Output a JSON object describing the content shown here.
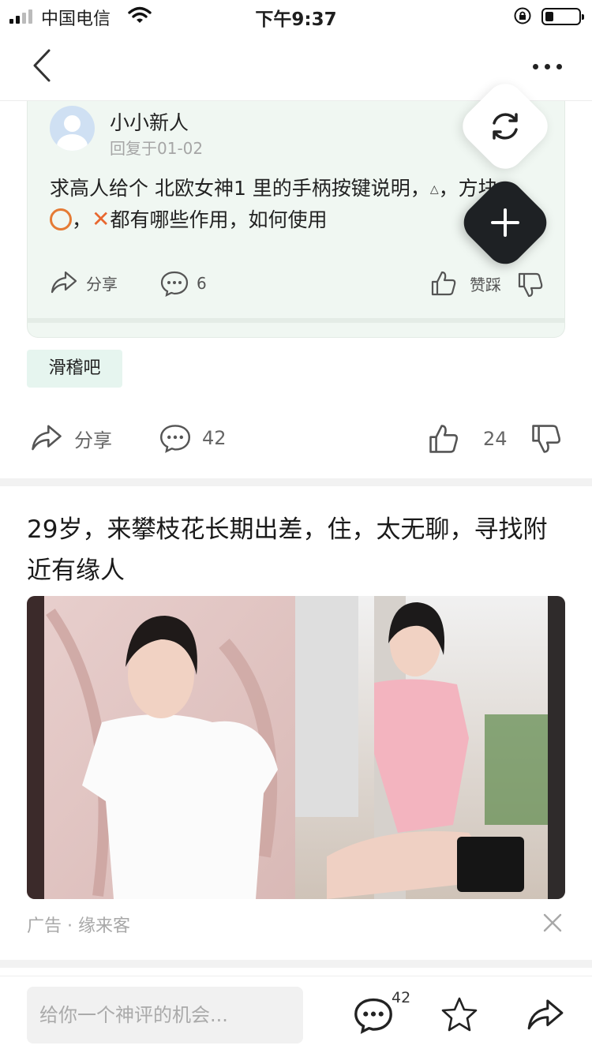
{
  "status_bar": {
    "carrier": "中国电信",
    "time": "下午9:37",
    "icons": [
      "signal-icon",
      "wifi-icon",
      "rotation-lock-icon",
      "battery-icon"
    ]
  },
  "nav": {
    "icons": [
      "back-arrow-icon",
      "more-dots-icon"
    ]
  },
  "quoted_reply": {
    "username": "小小新人",
    "reply_time": "回复于01-02",
    "content_part1": "求高人给个 北欧女神1 里的手柄按键说明，",
    "content_triangle": "△",
    "content_part2": "，方块，",
    "content_circle_sep": "，",
    "content_cross": "✕",
    "content_part3": "都有哪些作用，如何使用",
    "share_label": "分享",
    "comment_count": "6",
    "like_label": "赞踩"
  },
  "forum_tag": "滑稽吧",
  "post_actions": {
    "share_label": "分享",
    "comment_count": "42",
    "like_count": "24"
  },
  "ad": {
    "title": "29岁，来攀枝花长期出差，住，太无聊，寻找附近有缘人",
    "meta": "广告 · 缘来客"
  },
  "bottom_bar": {
    "input_placeholder": "给你一个神评的机会...",
    "comment_badge": "42"
  },
  "colors": {
    "quote_card_bg": "#f0f7f2",
    "tag_bg": "#e6f5ef",
    "fab_add": "#1e2124",
    "circle_orange": "#e57b35",
    "cross_orange": "#e8672f"
  }
}
